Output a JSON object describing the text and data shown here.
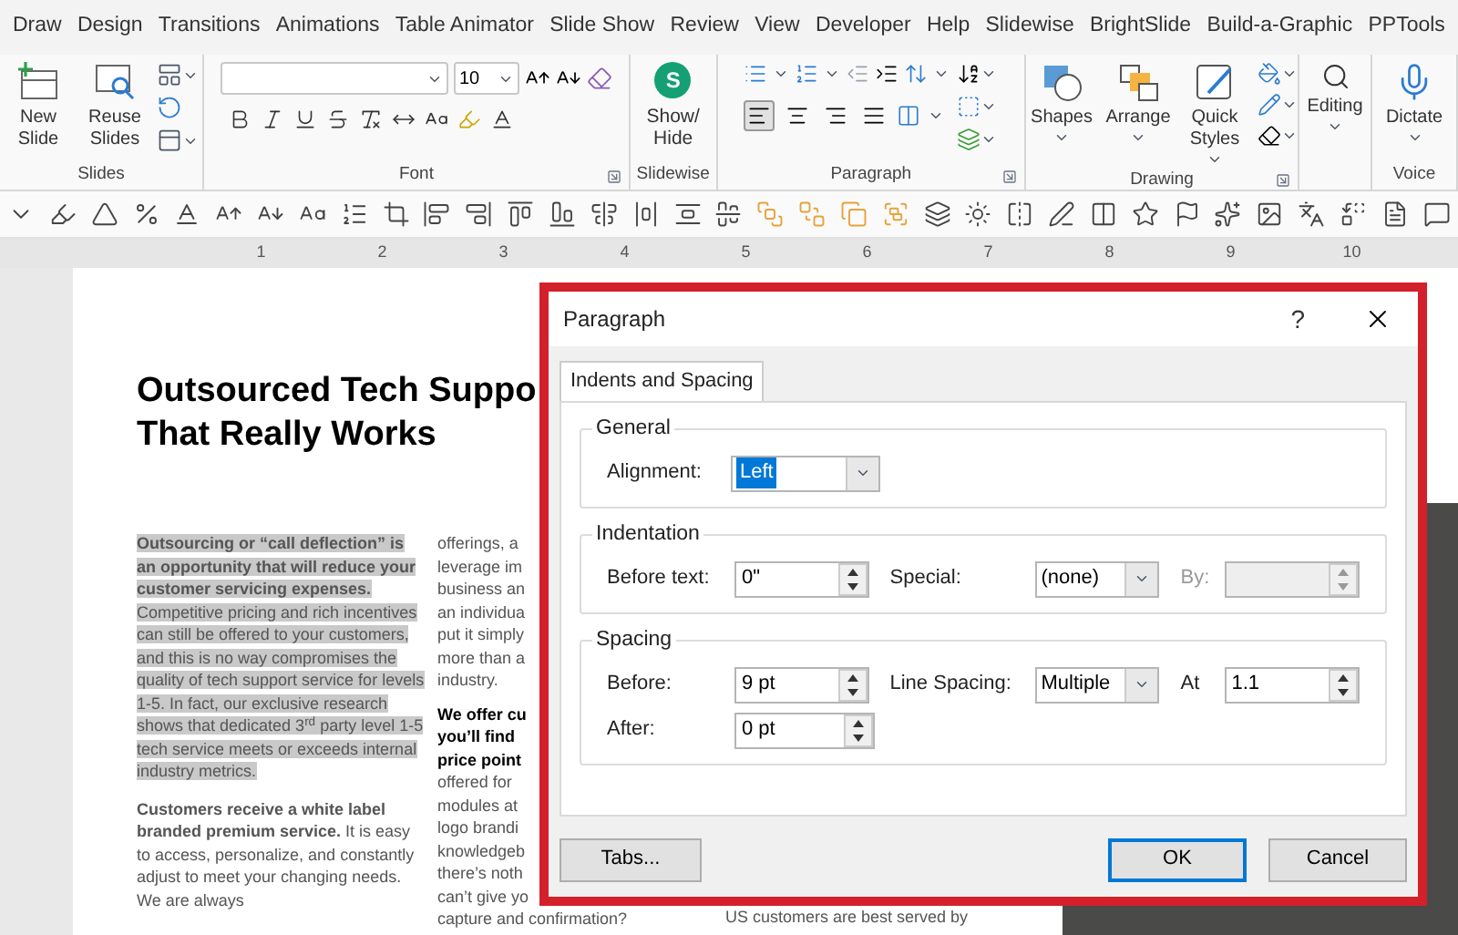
{
  "menu_tabs": [
    {
      "label": "Draw",
      "selected": false
    },
    {
      "label": "Design",
      "selected": false
    },
    {
      "label": "Transitions",
      "selected": false
    },
    {
      "label": "Animations",
      "selected": false
    },
    {
      "label": "Table Animator",
      "selected": false
    },
    {
      "label": "Slide Show",
      "selected": false
    },
    {
      "label": "Review",
      "selected": false
    },
    {
      "label": "View",
      "selected": false
    },
    {
      "label": "Developer",
      "selected": false
    },
    {
      "label": "Help",
      "selected": false
    },
    {
      "label": "Slidewise",
      "selected": false
    },
    {
      "label": "BrightSlide",
      "selected": false
    },
    {
      "label": "Build-a-Graphic",
      "selected": false
    },
    {
      "label": "PPTools",
      "selected": false
    }
  ],
  "ribbon": {
    "slides": {
      "label": "Slides",
      "new_slide": "New Slide",
      "reuse_slides": "Reuse Slides"
    },
    "font": {
      "label": "Font",
      "size": "10"
    },
    "slidewise": {
      "label": "Slidewise",
      "logo": "S",
      "button": "Show/ Hide"
    },
    "paragraph": {
      "label": "Paragraph",
      "alignments": [
        {
          "selected": true
        },
        {
          "selected": false
        },
        {
          "selected": false
        },
        {
          "selected": false
        }
      ]
    },
    "drawing": {
      "label": "Drawing",
      "buttons": [
        "Shapes",
        "Arrange",
        "Quick Styles"
      ]
    },
    "editing": {
      "button": "Editing"
    },
    "voice": {
      "label": "Voice",
      "button": "Dictate"
    }
  },
  "ruler": {
    "ticks": [
      "1",
      "2",
      "3",
      "4",
      "5",
      "6",
      "7",
      "8",
      "9",
      "10"
    ]
  },
  "slide": {
    "title": [
      "Outsourced Tech Suppo",
      "That Really Works"
    ],
    "column_1": [
      {
        "text": "**Outsourcing or “call deflection” is an opportunity that will reduce your customer servicing expenses.** Competitive pricing and rich incentives can still be offered to your customers, and this is no way compromises the quality of tech support service for levels 1-5. In fact, our exclusive research shows that dedicated 3$^{rd}$ party level 1-5 tech service meets or exceeds internal industry metrics.",
        "selected": true
      },
      {
        "text": "**Customers receive a white label branded premium service.** It is easy to access, personalize, and constantly adjust to meet your changing needs. We are always",
        "selected": false
      }
    ],
    "column_2": [
      {
        "text": "offerings, a",
        "bold": false
      },
      {
        "text": "leverage im",
        "bold": false
      },
      {
        "text": "business an",
        "bold": false
      },
      {
        "text": "an individua",
        "bold": false
      },
      {
        "text": "put it simply",
        "bold": false
      },
      {
        "text": "more than a",
        "bold": false
      },
      {
        "text": "industry.",
        "bold": false
      },
      {
        "text": "We offer cu",
        "bold": true
      },
      {
        "text": "you’ll find",
        "bold": true
      },
      {
        "text": "price point",
        "bold": true
      },
      {
        "text": "offered for",
        "bold": false
      },
      {
        "text": "modules at",
        "bold": false
      },
      {
        "text": "logo brandi",
        "bold": false
      },
      {
        "text": "knowledgeb",
        "bold": false
      },
      {
        "text": "there’s noth",
        "bold": false
      },
      {
        "text": "can’t give yo",
        "bold": false
      },
      {
        "text": "capture and confirmation?",
        "bold": false
      }
    ],
    "column_3": [
      "US customers are best served by"
    ]
  },
  "dialog": {
    "title": "Paragraph",
    "help": "?",
    "tabs": [
      {
        "label": "Indents and Spacing",
        "selected": true
      }
    ],
    "general": {
      "label": "General",
      "alignment_label": "Alignment:",
      "alignment": "Left"
    },
    "indentation": {
      "label": "Indentation",
      "before_text_label": "Before text:",
      "before_text": "0\"",
      "special_label": "Special:",
      "special": "(none)",
      "by_label": "By:",
      "by_disabled": true
    },
    "spacing": {
      "label": "Spacing",
      "before_label": "Before:",
      "before": "9 pt",
      "after_label": "After:",
      "after": "0 pt",
      "line_spacing_label": "Line Spacing:",
      "line_spacing": "Multiple",
      "at_label": "At",
      "at": "1.1"
    },
    "buttons": {
      "tabs": "Tabs...",
      "ok": "OK",
      "cancel": "Cancel"
    }
  }
}
